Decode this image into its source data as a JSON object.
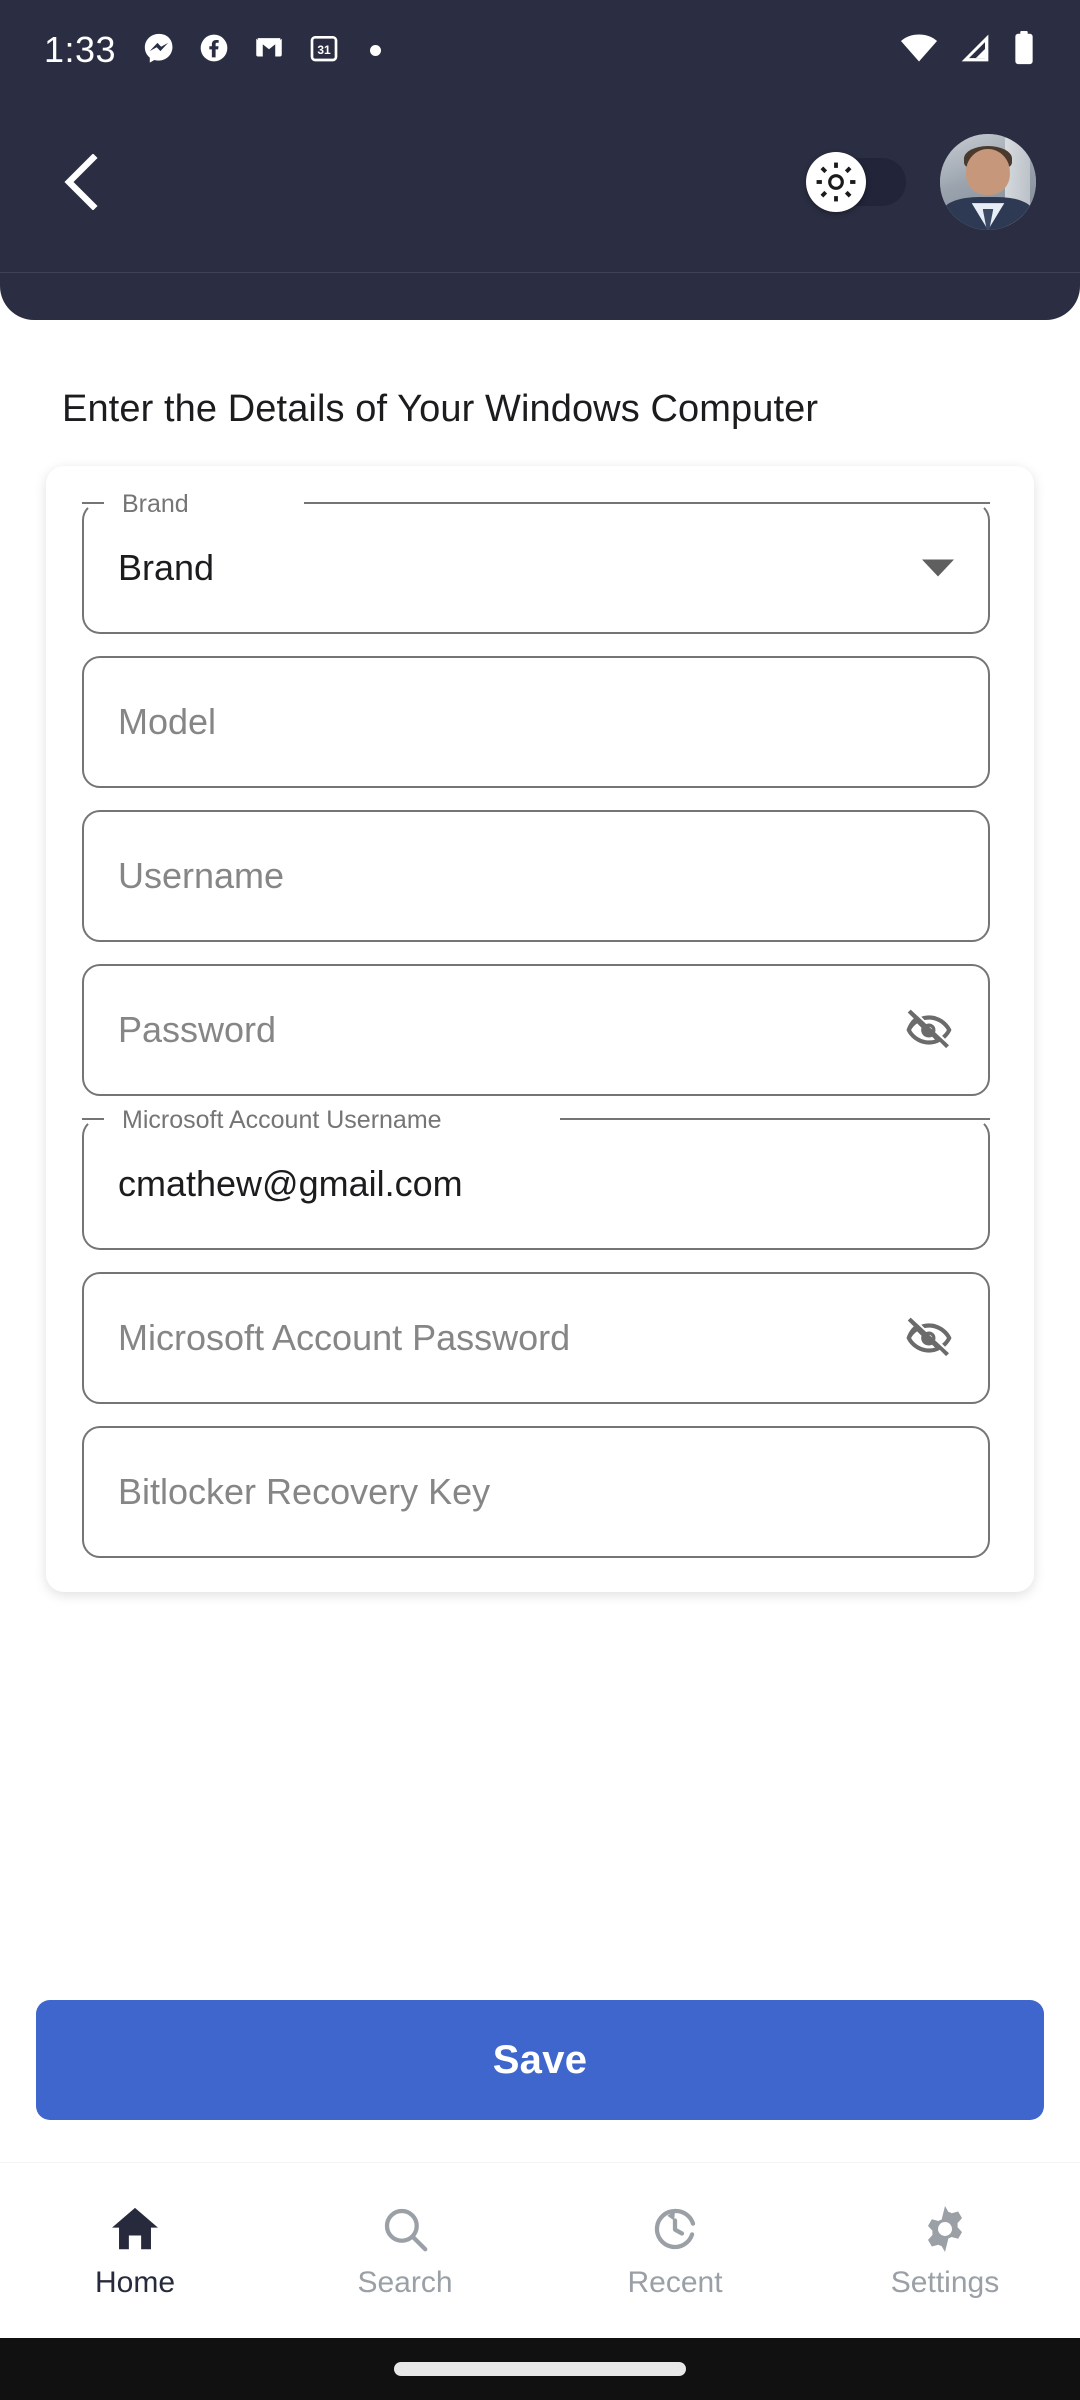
{
  "status_bar": {
    "time": "1:33",
    "left_icons": [
      "messenger-icon",
      "facebook-icon",
      "gmail-icon",
      "calendar-icon",
      "dot-icon"
    ],
    "calendar_day": "31",
    "right_icons": [
      "wifi-icon",
      "cellular-signal-icon",
      "battery-icon"
    ],
    "background": "#2b2e42"
  },
  "app_bar": {
    "back_icon": "chevron-left-icon",
    "theme_toggle": {
      "icon": "sun-icon",
      "state": "off",
      "track_color": "#22243a"
    },
    "avatar": "user-avatar",
    "background": "#2b2e42"
  },
  "page": {
    "heading": "Enter the Details of Your Windows Computer"
  },
  "form": {
    "fields": [
      {
        "name": "brand",
        "label": "Brand",
        "value": "Brand",
        "placeholder": "Brand",
        "type": "dropdown",
        "has_label_notch": true,
        "trailing_icon": "chevron-down-icon"
      },
      {
        "name": "model",
        "label": "Model",
        "value": "",
        "placeholder": "Model",
        "type": "text",
        "has_label_notch": false,
        "trailing_icon": ""
      },
      {
        "name": "username",
        "label": "Username",
        "value": "",
        "placeholder": "Username",
        "type": "text",
        "has_label_notch": false,
        "trailing_icon": ""
      },
      {
        "name": "password",
        "label": "Password",
        "value": "",
        "placeholder": "Password",
        "type": "password",
        "has_label_notch": false,
        "trailing_icon": "eye-off-icon"
      },
      {
        "name": "microsoft-account-username",
        "label": "Microsoft Account Username",
        "value": "cmathew@gmail.com",
        "placeholder": "Microsoft Account Username",
        "type": "text",
        "has_label_notch": true,
        "trailing_icon": ""
      },
      {
        "name": "microsoft-account-password",
        "label": "Microsoft Account Password",
        "value": "",
        "placeholder": "Microsoft Account Password",
        "type": "password",
        "has_label_notch": false,
        "trailing_icon": "eye-off-icon"
      },
      {
        "name": "bitlocker-recovery-key",
        "label": "Bitlocker Recovery Key",
        "value": "",
        "placeholder": "Bitlocker Recovery Key",
        "type": "text",
        "has_label_notch": false,
        "trailing_icon": ""
      }
    ]
  },
  "save_button": {
    "label": "Save",
    "color": "#3f66cd"
  },
  "bottom_nav": {
    "active_index": 0,
    "items": [
      {
        "label": "Home",
        "icon": "home-icon"
      },
      {
        "label": "Search",
        "icon": "search-icon"
      },
      {
        "label": "Recent",
        "icon": "history-icon"
      },
      {
        "label": "Settings",
        "icon": "gear-icon"
      }
    ],
    "active_color": "#272a3d",
    "inactive_color": "#9aa0a6"
  },
  "gesture_bar": {
    "handle": "gesture-handle"
  }
}
